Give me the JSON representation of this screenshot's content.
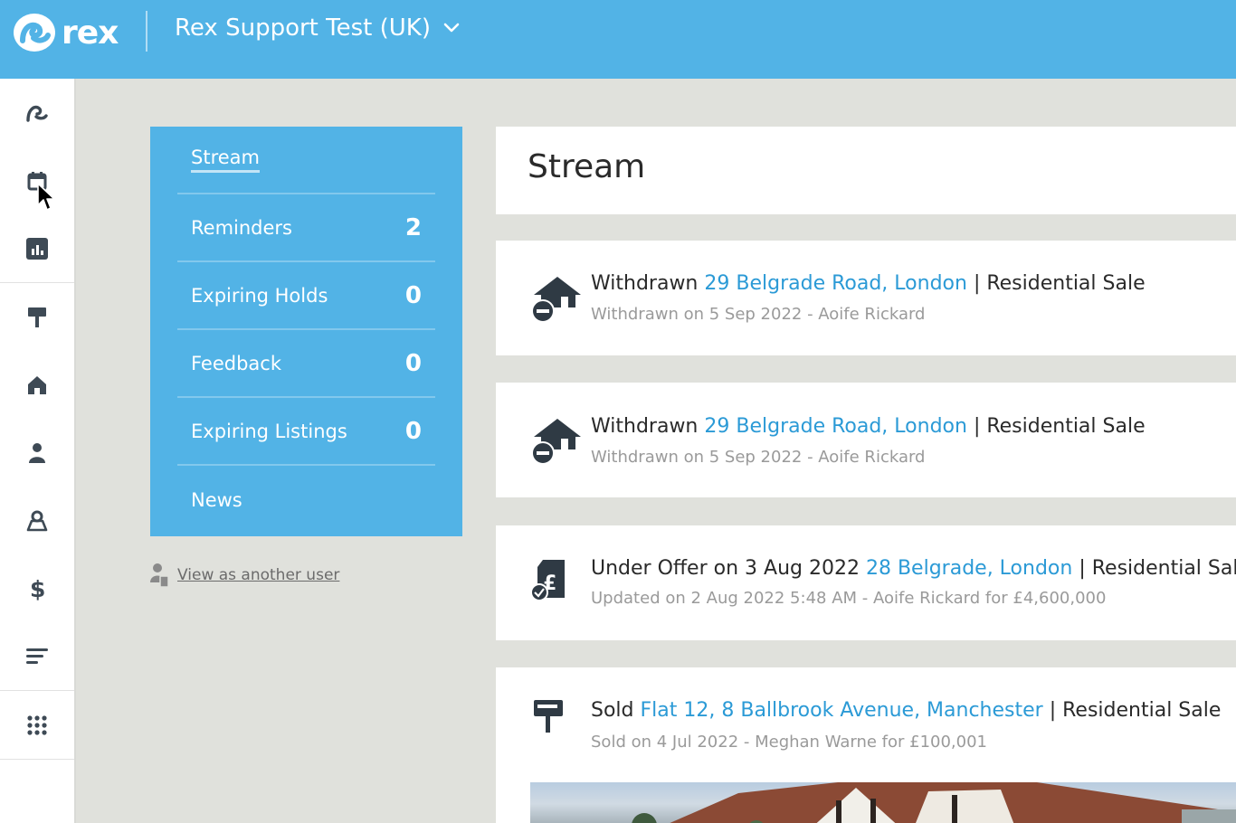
{
  "app": {
    "logo_text": "rex",
    "account_name": "Rex Support Test (UK)"
  },
  "sidenav": {
    "items": [
      {
        "name": "home-icon"
      },
      {
        "name": "calendar-icon"
      },
      {
        "name": "reports-icon"
      },
      {
        "name": "listings-sign-icon"
      },
      {
        "name": "properties-house-icon"
      },
      {
        "name": "contacts-person-icon"
      },
      {
        "name": "map-pin-icon"
      },
      {
        "name": "finance-dollar-icon"
      },
      {
        "name": "lists-icon"
      },
      {
        "name": "apps-grid-icon"
      }
    ]
  },
  "panel": {
    "items": [
      {
        "label": "Stream",
        "count": ""
      },
      {
        "label": "Reminders",
        "count": "2"
      },
      {
        "label": "Expiring Holds",
        "count": "0"
      },
      {
        "label": "Feedback",
        "count": "0"
      },
      {
        "label": "Expiring Listings",
        "count": "0"
      },
      {
        "label": "News",
        "count": ""
      }
    ],
    "view_as": "View as another user"
  },
  "stream": {
    "title": "Stream",
    "cards": [
      {
        "prefix": "Withdrawn",
        "link": "29 Belgrade Road, London",
        "suffix": "| Residential Sale",
        "sub": "Withdrawn on 5 Sep 2022 - Aoife Rickard"
      },
      {
        "prefix": "Withdrawn",
        "link": "29 Belgrade Road, London",
        "suffix": "| Residential Sale",
        "sub": "Withdrawn on 5 Sep 2022 - Aoife Rickard"
      },
      {
        "prefix": "Under Offer on 3 Aug 2022",
        "link": "28 Belgrade, London",
        "suffix": "| Residential Sale",
        "sub": "Updated on 2 Aug 2022 5:48 AM - Aoife Rickard for £4,600,000"
      },
      {
        "prefix": "Sold",
        "link": "Flat 12, 8 Ballbrook Avenue, Manchester",
        "suffix": "| Residential Sale",
        "sub": "Sold on 4 Jul 2022 - Meghan Warne for £100,001"
      }
    ]
  },
  "colors": {
    "brand": "#52b3e6",
    "link": "#2b9ad6",
    "background": "#e0e1dc"
  }
}
